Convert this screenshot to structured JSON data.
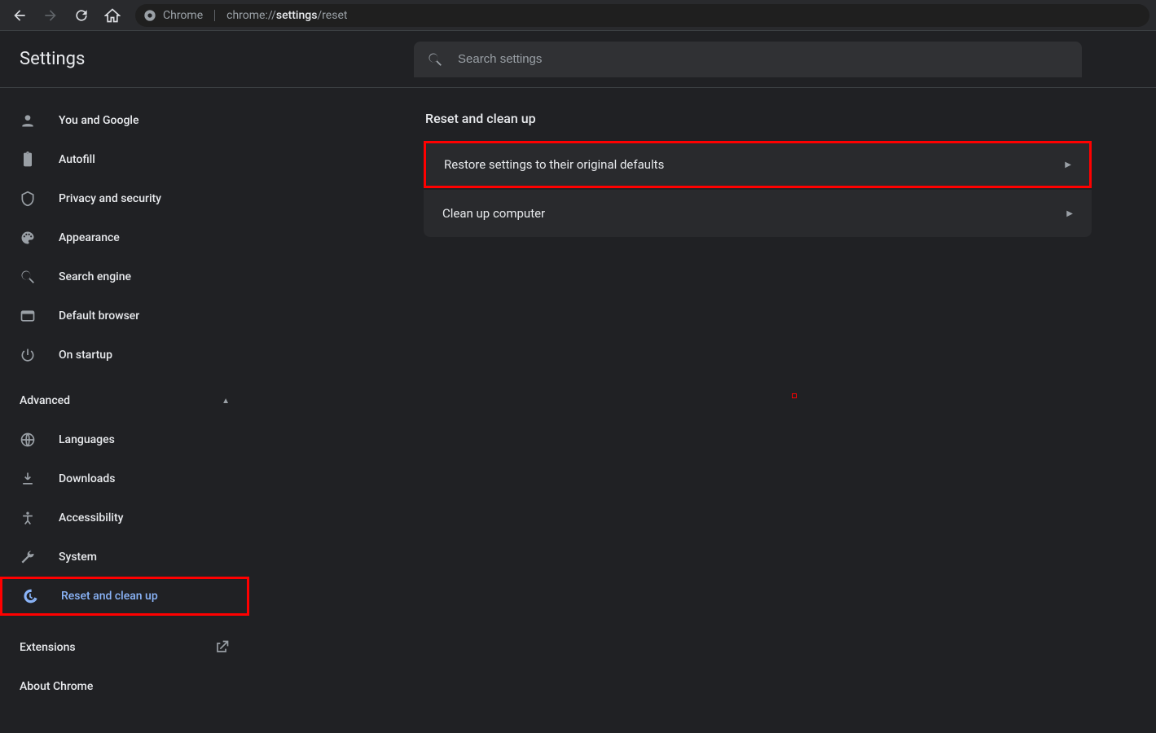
{
  "toolbar": {
    "omnibox_prefix": "Chrome",
    "omnibox_url_dim": "chrome://",
    "omnibox_url_bold": "settings",
    "omnibox_url_after": "/reset"
  },
  "header": {
    "title": "Settings",
    "search_placeholder": "Search settings"
  },
  "sidebar": {
    "items": [
      {
        "icon": "person",
        "label": "You and Google"
      },
      {
        "icon": "clipboard",
        "label": "Autofill"
      },
      {
        "icon": "shield",
        "label": "Privacy and security"
      },
      {
        "icon": "palette",
        "label": "Appearance"
      },
      {
        "icon": "search",
        "label": "Search engine"
      },
      {
        "icon": "browser",
        "label": "Default browser"
      },
      {
        "icon": "power",
        "label": "On startup"
      }
    ],
    "advanced": {
      "title": "Advanced",
      "items": [
        {
          "icon": "globe",
          "label": "Languages"
        },
        {
          "icon": "download",
          "label": "Downloads"
        },
        {
          "icon": "accessibility",
          "label": "Accessibility"
        },
        {
          "icon": "wrench",
          "label": "System"
        },
        {
          "icon": "restore",
          "label": "Reset and clean up",
          "selected": true,
          "highlighted": true
        }
      ]
    },
    "links": [
      {
        "label": "Extensions",
        "external": true
      },
      {
        "label": "About Chrome"
      }
    ]
  },
  "main": {
    "heading": "Reset and clean up",
    "rows": [
      {
        "label": "Restore settings to their original defaults",
        "highlighted": true
      },
      {
        "label": "Clean up computer"
      }
    ]
  }
}
